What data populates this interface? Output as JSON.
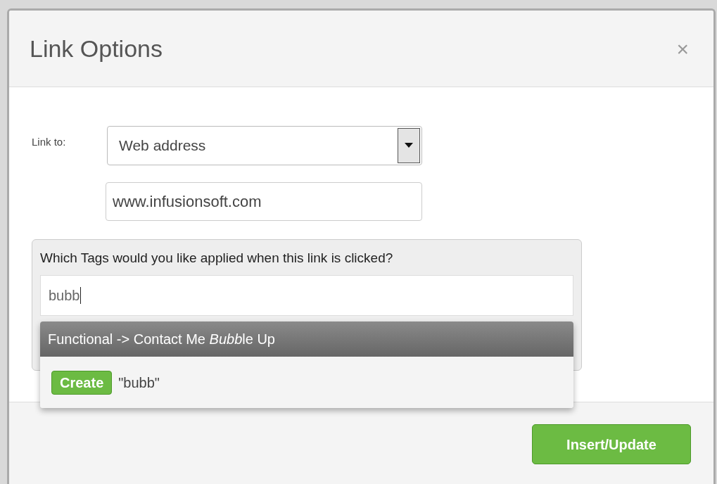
{
  "dialog": {
    "title": "Link Options",
    "close": "×"
  },
  "link_to": {
    "label": "Link to:",
    "value": "Web address"
  },
  "url": {
    "value": "www.infusionsoft.com"
  },
  "tags": {
    "question": "Which Tags would you like applied when this link is clicked?",
    "value": "bubb",
    "suggestions": [
      {
        "kind": "match",
        "parts": [
          {
            "text": "Functional -> Contact Me ",
            "italic": false
          },
          {
            "text": "Bubb",
            "italic": true
          },
          {
            "text": "le Up",
            "italic": false
          }
        ],
        "selected": true
      },
      {
        "kind": "create",
        "button": "Create",
        "text": "\"bubb\"",
        "selected": false
      }
    ]
  },
  "buttons": [
    "Insert/Update"
  ]
}
